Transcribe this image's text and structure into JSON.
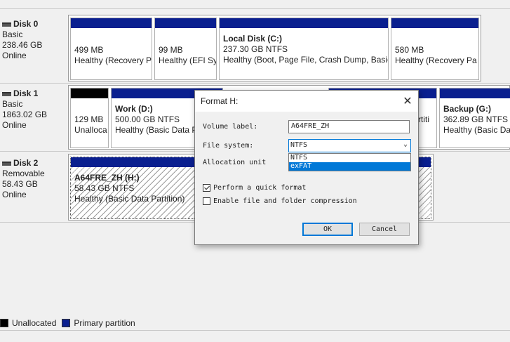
{
  "disks": [
    {
      "name": "Disk 0",
      "info": [
        "Basic",
        "238.46 GB",
        "Online"
      ],
      "partitions": [
        {
          "name": "",
          "lines": [
            "499 MB",
            "Healthy (Recovery P"
          ],
          "type": "primary"
        },
        {
          "name": "",
          "lines": [
            "99 MB",
            "Healthy (EFI Sy"
          ],
          "type": "primary"
        },
        {
          "name": "Local Disk  (C:)",
          "lines": [
            "237.30 GB NTFS",
            "Healthy (Boot, Page File, Crash Dump, Basic"
          ],
          "type": "primary"
        },
        {
          "name": "",
          "lines": [
            "580 MB",
            "Healthy (Recovery Pa"
          ],
          "type": "primary"
        }
      ]
    },
    {
      "name": "Disk 1",
      "info": [
        "Basic",
        "1863.02 GB",
        "Online"
      ],
      "partitions": [
        {
          "name": "",
          "lines": [
            "129 MB",
            "Unalloca"
          ],
          "type": "unallocated"
        },
        {
          "name": "Work  (D:)",
          "lines": [
            "500.00 GB NTFS",
            "Healthy (Basic Data P"
          ],
          "type": "primary"
        },
        {
          "name": "",
          "lines": [
            "",
            "rtiti"
          ],
          "type": "primary"
        },
        {
          "name": "Backup  (G:)",
          "lines": [
            "362.89 GB NTFS",
            "Healthy (Basic Dat"
          ],
          "type": "primary"
        }
      ]
    },
    {
      "name": "Disk 2",
      "info": [
        "Removable",
        "58.43 GB",
        "Online"
      ],
      "partitions": [
        {
          "name": "A64FRE_ZH  (H:)",
          "lines": [
            "58.43 GB NTFS",
            "Healthy (Basic Data Partition)"
          ],
          "type": "primary-selected"
        }
      ]
    }
  ],
  "legend": [
    {
      "label": "Unallocated",
      "color": "#000000"
    },
    {
      "label": "Primary partition",
      "color": "#0a1f8f"
    }
  ],
  "dialog": {
    "title": "Format H:",
    "close_glyph": "✕",
    "volume_label_label": "Volume label:",
    "volume_label_value": "A64FRE_ZH",
    "file_system_label": "File system:",
    "file_system_value": "NTFS",
    "file_system_options": [
      "NTFS",
      "exFAT"
    ],
    "file_system_highlighted": "exFAT",
    "allocation_unit_label": "Allocation unit",
    "quick_format_label": "Perform a quick format",
    "quick_format_checked": true,
    "compression_label": "Enable file and folder compression",
    "compression_checked": false,
    "ok_label": "OK",
    "cancel_label": "Cancel"
  },
  "icons": {
    "disk": "disk-icon",
    "close": "close-icon",
    "dropdown": "chevron-down-icon",
    "checkbox_checked": "checkmark-icon"
  },
  "colors": {
    "primary_partition": "#0a1f8f",
    "unallocated": "#000000",
    "accent": "#0078d7"
  }
}
